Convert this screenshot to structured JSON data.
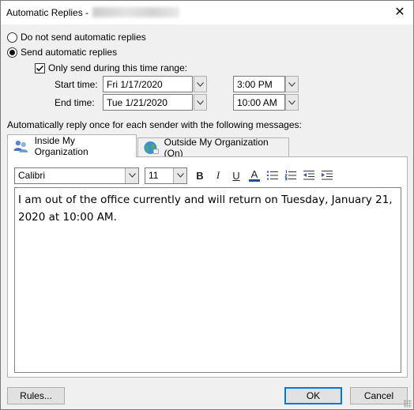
{
  "window": {
    "title": "Automatic Replies - ",
    "close_glyph": "✕"
  },
  "options": {
    "do_not_send_label": "Do not send automatic replies",
    "send_label": "Send automatic replies",
    "selected": "send",
    "time_range_label": "Only send during this time range:",
    "time_range_checked": true
  },
  "start": {
    "label": "Start time:",
    "date": "Fri 1/17/2020",
    "time": "3:00 PM"
  },
  "end": {
    "label": "End time:",
    "date": "Tue 1/21/2020",
    "time": "10:00 AM"
  },
  "instruction": "Automatically reply once for each sender with the following messages:",
  "tabs": [
    {
      "label": "Inside My Organization",
      "active": true,
      "icon": "people-icon"
    },
    {
      "label": "Outside My Organization (On)",
      "active": false,
      "icon": "globe-icon"
    }
  ],
  "toolbar": {
    "font": "Calibri",
    "size": "11",
    "bold": "B",
    "italic": "I",
    "underline": "U",
    "font_color": "A",
    "font_color_hex": "#1f4e9c"
  },
  "message": "I am out of the office currently and will return on Tuesday, January 21, 2020 at 10:00 AM.",
  "buttons": {
    "rules": "Rules...",
    "ok": "OK",
    "cancel": "Cancel"
  },
  "colors": {
    "accent": "#0078d7"
  }
}
